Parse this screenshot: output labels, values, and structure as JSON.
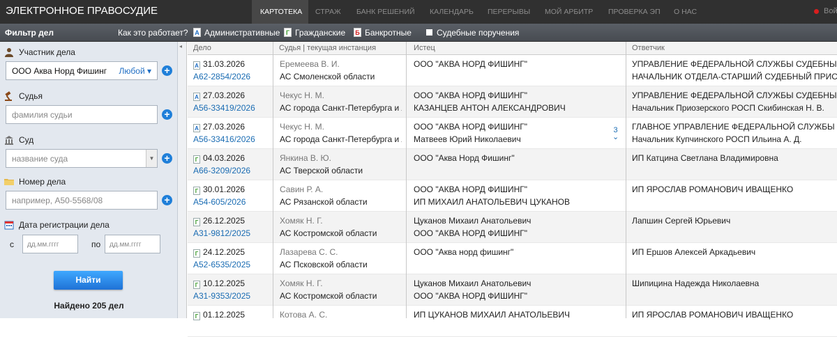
{
  "header": {
    "site_title": "ЭЛЕКТРОННОЕ ПРАВОСУДИЕ",
    "nav": [
      "КАРТОТЕКА",
      "СТРАЖ",
      "БАНК РЕШЕНИЙ",
      "КАЛЕНДАРЬ",
      "ПЕРЕРЫВЫ",
      "МОЙ АРБИТР",
      "ПРОВЕРКА ЭП",
      "О НАС"
    ],
    "user": "Войти"
  },
  "filterbar": {
    "title": "Фильтр дел",
    "how_link": "Как это работает?",
    "types": [
      {
        "icon": "А",
        "label": "Административные",
        "color": "#1f6ec4"
      },
      {
        "icon": "Г",
        "label": "Гражданские",
        "color": "#3a9a2a"
      },
      {
        "icon": "Б",
        "label": "Банкротные",
        "color": "#d42020"
      },
      {
        "icon": "",
        "label": "Судебные поручения",
        "color": "#ffffff"
      }
    ]
  },
  "sidebar": {
    "participant_label": "Участник дела",
    "participant_value": "ООО Аква Норд Фишинг",
    "participant_any": "Любой",
    "judge_label": "Судья",
    "judge_placeholder": "фамилия судьи",
    "court_label": "Суд",
    "court_placeholder": "название суда",
    "case_label": "Номер дела",
    "case_placeholder": "например, А50-5568/08",
    "date_label": "Дата регистрации дела",
    "from_label": "с",
    "to_label": "по",
    "date_placeholder": "дд.мм.гггг",
    "find_button": "Найти",
    "found_text": "Найдено 205 дел"
  },
  "table": {
    "columns": [
      "Дело",
      "Судья | текущая инстанция",
      "Истец",
      "Ответчик"
    ],
    "rows": [
      {
        "type": "А",
        "date": "31.03.2026",
        "case": "А62-2854/2026",
        "judge": "Еремеева В. И.",
        "court": "АС Смоленской области",
        "plaintiff": [
          "ООО \"АКВА НОРД ФИШИНГ\""
        ],
        "defendant": [
          "УПРАВЛЕНИЕ ФЕДЕРАЛЬНОЙ СЛУЖБЫ СУДЕБНЫХ ПРИСТАВОВ",
          "НАЧАЛЬНИК ОТДЕЛА-СТАРШИЙ СУДЕБНЫЙ ПРИСТАВ ПРИ"
        ],
        "more": ""
      },
      {
        "type": "А",
        "date": "27.03.2026",
        "case": "А56-33419/2026",
        "judge": "Чекус Н. М.",
        "court": "АС города Санкт-Петербурга и Лен",
        "plaintiff": [
          "ООО \"АКВА НОРД ФИШИНГ\"",
          "КАЗАНЦЕВ АНТОН АЛЕКСАНДРОВИЧ"
        ],
        "defendant": [
          "УПРАВЛЕНИЕ ФЕДЕРАЛЬНОЙ СЛУЖБЫ СУДЕБНЫХ ПРИСТАВОВ",
          "Начальник Приозерского РОСП Скибинская Н. В."
        ],
        "more": ""
      },
      {
        "type": "А",
        "date": "27.03.2026",
        "case": "А56-33416/2026",
        "judge": "Чекус Н. М.",
        "court": "АС города Санкт-Петербурга и Лен",
        "plaintiff": [
          "ООО \"АКВА НОРД ФИШИНГ\"",
          "Матвеев Юрий Николаевич"
        ],
        "defendant": [
          "ГЛАВНОЕ УПРАВЛЕНИЕ ФЕДЕРАЛЬНОЙ СЛУЖБЫ СУДЕБНЫХ ПРИСТАВОВ",
          "Начальник Купчинского РОСП Ильина А. Д."
        ],
        "more": "3"
      },
      {
        "type": "Г",
        "date": "04.03.2026",
        "case": "А66-3209/2026",
        "judge": "Янкина В. Ю.",
        "court": "АС Тверской области",
        "plaintiff": [
          "ООО \"Аква Норд Фишинг\""
        ],
        "defendant": [
          "ИП Катцина Светлана Владимировна"
        ],
        "more": ""
      },
      {
        "type": "Г",
        "date": "30.01.2026",
        "case": "А54-605/2026",
        "judge": "Савин Р. А.",
        "court": "АС Рязанской области",
        "plaintiff": [
          "ООО \"АКВА НОРД ФИШИНГ\"",
          "ИП МИХАИЛ АНАТОЛЬЕВИЧ ЦУКАНОВ"
        ],
        "defendant": [
          "ИП ЯРОСЛАВ РОМАНОВИЧ ИВАЩЕНКО"
        ],
        "more": ""
      },
      {
        "type": "Г",
        "date": "26.12.2025",
        "case": "А31-9812/2025",
        "judge": "Хомяк Н. Г.",
        "court": "АС Костромской области",
        "plaintiff": [
          "Цуканов Михаил Анатольевич",
          "ООО \"АКВА НОРД ФИШИНГ\""
        ],
        "defendant": [
          "Лапшин Сергей Юрьевич"
        ],
        "more": ""
      },
      {
        "type": "Г",
        "date": "24.12.2025",
        "case": "А52-6535/2025",
        "judge": "Лазарева С. С.",
        "court": "АС Псковской области",
        "plaintiff": [
          "ООО \"Аква норд фишинг\""
        ],
        "defendant": [
          "ИП Ершов Алексей Аркадьевич"
        ],
        "more": ""
      },
      {
        "type": "Г",
        "date": "10.12.2025",
        "case": "А31-9353/2025",
        "judge": "Хомяк Н. Г.",
        "court": "АС Костромской области",
        "plaintiff": [
          "Цуканов Михаил Анатольевич",
          "ООО \"АКВА НОРД ФИШИНГ\""
        ],
        "defendant": [
          "Шипицина Надежда Николаевна"
        ],
        "more": ""
      },
      {
        "type": "Г",
        "date": "01.12.2025",
        "case": "",
        "judge": "Котова А. С.",
        "court": "",
        "plaintiff": [
          "ИП ЦУКАНОВ МИХАИЛ АНАТОЛЬЕВИЧ"
        ],
        "defendant": [
          "ИП ЯРОСЛАВ РОМАНОВИЧ ИВАЩЕНКО"
        ],
        "more": ""
      }
    ]
  }
}
